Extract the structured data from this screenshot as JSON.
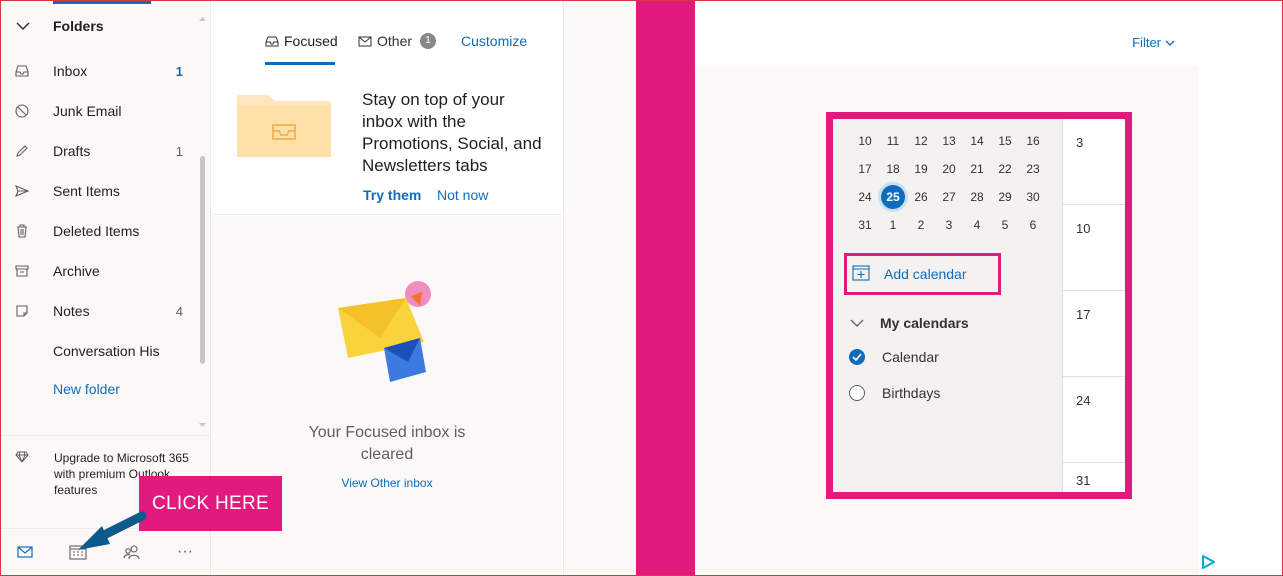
{
  "sidebar": {
    "folders_label": "Folders",
    "items": [
      {
        "name": "Inbox",
        "count": "1",
        "icon": "inbox-icon"
      },
      {
        "name": "Junk Email",
        "count": "",
        "icon": "junk-icon"
      },
      {
        "name": "Drafts",
        "count": "1",
        "icon": "pencil-icon"
      },
      {
        "name": "Sent Items",
        "count": "",
        "icon": "send-icon"
      },
      {
        "name": "Deleted Items",
        "count": "",
        "icon": "trash-icon"
      },
      {
        "name": "Archive",
        "count": "",
        "icon": "archive-icon"
      },
      {
        "name": "Notes",
        "count": "4",
        "icon": "note-icon"
      },
      {
        "name": "Conversation Hist...",
        "count": "",
        "icon": ""
      }
    ],
    "new_folder": "New folder",
    "upgrade_text": "Upgrade to Microsoft 365 with premium Outlook features",
    "nav": [
      "mail-icon",
      "calendar-icon",
      "people-icon",
      "more-icon"
    ],
    "more_label": "···"
  },
  "callout": {
    "text": "CLICK HERE",
    "color": "#e21a7d"
  },
  "maillist": {
    "tabs": {
      "focused": "Focused",
      "other": "Other",
      "other_count": "1",
      "customize": "Customize"
    },
    "promo": {
      "title": "Stay on top of your inbox with the Promotions, Social, and Newsletters tabs",
      "try": "Try them",
      "not_now": "Not now"
    },
    "empty": {
      "message": "Your Focused inbox is cleared",
      "view_other": "View Other inbox"
    }
  },
  "calendar_panel": {
    "filter": "Filter",
    "mini_calendar": {
      "weeks": [
        [
          "10",
          "11",
          "12",
          "13",
          "14",
          "15",
          "16"
        ],
        [
          "17",
          "18",
          "19",
          "20",
          "21",
          "22",
          "23"
        ],
        [
          "24",
          "25",
          "26",
          "27",
          "28",
          "29",
          "30"
        ],
        [
          "31",
          "1",
          "2",
          "3",
          "4",
          "5",
          "6"
        ]
      ],
      "today": "25"
    },
    "add_calendar": "Add calendar",
    "my_calendars": "My calendars",
    "calendars": [
      {
        "name": "Calendar",
        "checked": true
      },
      {
        "name": "Birthdays",
        "checked": false
      }
    ],
    "week_column": [
      "3",
      "10",
      "17",
      "24",
      "31"
    ]
  },
  "colors": {
    "accent": "#0f6cbd",
    "highlight": "#e21a7d"
  }
}
